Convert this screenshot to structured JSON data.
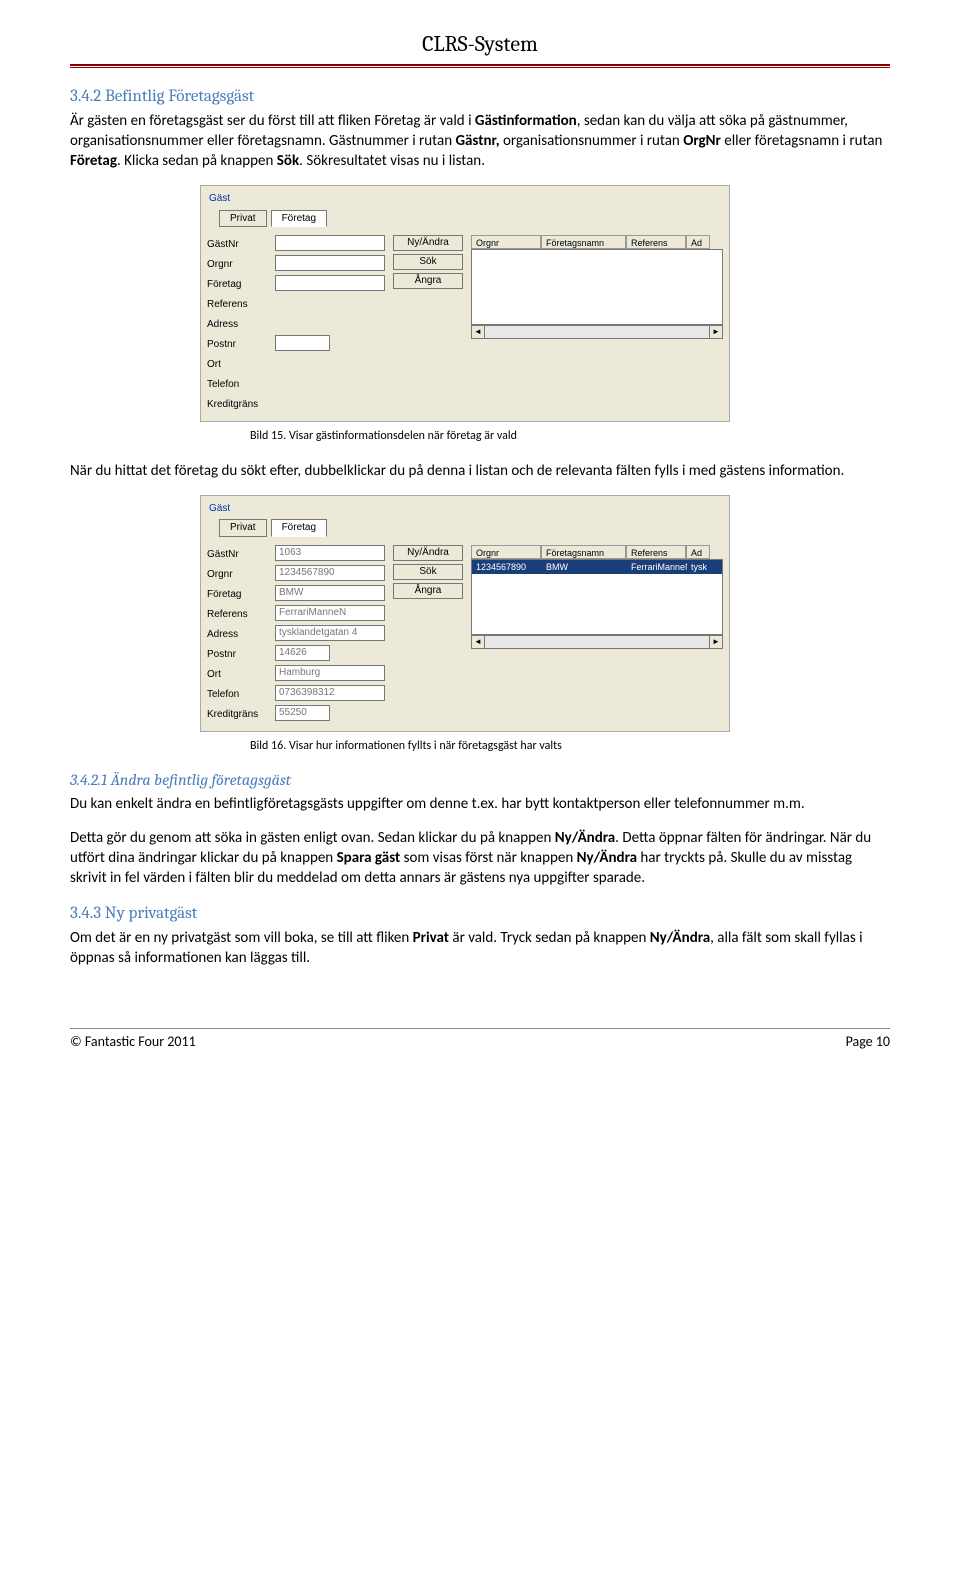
{
  "header": {
    "title": "CLRS-System"
  },
  "section1": {
    "heading": "3.4.2 Befintlig Företagsgäst",
    "p1a": "Är gästen en företagsgäst ser du först till att fliken Företag är vald i ",
    "p1b": "Gästinformation",
    "p1c": ", sedan kan du välja att söka på gästnummer, organisationsnummer eller företagsnamn. Gästnummer i rutan ",
    "p1d": "Gästnr,",
    "p1e": " organisationsnummer i rutan ",
    "p1f": "OrgNr",
    "p1g": " eller företagsnamn i rutan ",
    "p1h": "Företag",
    "p1i": ". Klicka sedan på knappen ",
    "p1j": "Sök",
    "p1k": ". Sökresultatet visas nu i listan."
  },
  "shot1": {
    "group": "Gäst",
    "tab_privat": "Privat",
    "tab_foretag": "Företag",
    "labels": [
      "GästNr",
      "Orgnr",
      "Företag",
      "Referens",
      "Adress",
      "Postnr",
      "Ort",
      "Telefon",
      "Kreditgräns"
    ],
    "btn_ny": "Ny/Ändra",
    "btn_sok": "Sök",
    "btn_angra": "Ångra",
    "head_orgnr": "Orgnr",
    "head_namn": "Företagsnamn",
    "head_ref": "Referens",
    "head_ad": "Ad"
  },
  "caption1": "Bild 15. Visar gästinformationsdelen när företag är vald",
  "midpara": "När du hittat det företag du sökt efter, dubbelklickar du på denna i listan och de relevanta fälten fylls i med gästens information.",
  "shot2": {
    "vals": {
      "gastnr": "1063",
      "orgnr": "1234567890",
      "foretag": "BMW",
      "referens": "FerrariManneN",
      "adress": "tysklandetgatan 4",
      "postnr": "14626",
      "ort": "Hamburg",
      "telefon": "0736398312",
      "kredit": "55250"
    },
    "row": {
      "orgnr": "1234567890",
      "namn": "BMW",
      "ref": "FerrariManneN",
      "ad": "tysk"
    }
  },
  "caption2": "Bild 16. Visar hur informationen fyllts i när företagsgäst har valts",
  "section2": {
    "heading": "3.4.2.1 Ändra befintlig företagsgäst",
    "p1": "Du kan enkelt ändra en befintligföretagsgästs uppgifter om denne t.ex. har bytt kontaktperson eller telefonnummer m.m.",
    "p2a": "Detta gör du genom att söka in gästen enligt ovan. Sedan klickar du på knappen ",
    "p2b": "Ny/Ändra",
    "p2c": ". Detta öppnar fälten för ändringar. När du utfört dina ändringar klickar du på knappen ",
    "p2d": "Spara gäst",
    "p2e": " som visas först när knappen ",
    "p2f": "Ny/Ändra",
    "p2g": " har tryckts på. Skulle du av misstag skrivit in fel värden i fälten blir du meddelad om detta annars är gästens nya uppgifter sparade."
  },
  "section3": {
    "heading": "3.4.3 Ny privatgäst",
    "p1a": "Om det är en ny privatgäst som vill boka, se till att fliken ",
    "p1b": "Privat",
    "p1c": " är vald. Tryck sedan på knappen ",
    "p1d": "Ny/Ändra",
    "p1e": ", alla fält som skall fyllas i öppnas så informationen kan läggas till."
  },
  "footer": {
    "left": "© Fantastic Four 2011",
    "right": "Page 10"
  }
}
